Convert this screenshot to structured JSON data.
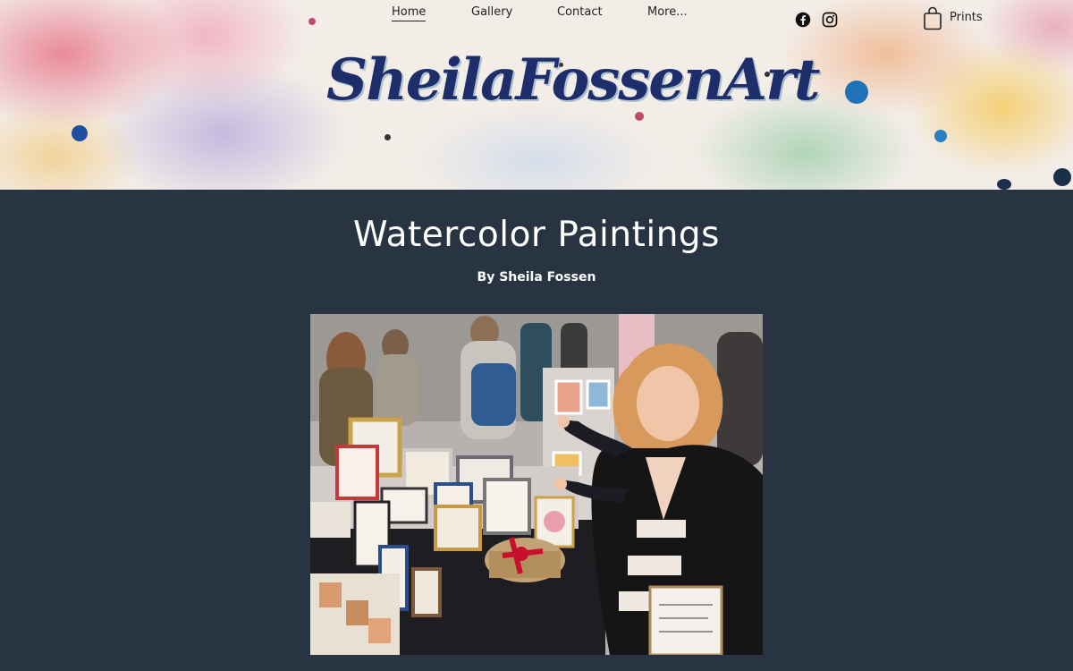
{
  "header": {
    "logo_text": "SheilaFossenArt",
    "nav": [
      {
        "label": "Home",
        "active": true
      },
      {
        "label": "Gallery",
        "active": false
      },
      {
        "label": "Contact",
        "active": false
      },
      {
        "label": "More...",
        "active": false
      }
    ],
    "social": [
      "facebook-icon",
      "instagram-icon"
    ],
    "cart_icon": "shopping-bag-icon",
    "cart_label": "Prints"
  },
  "main": {
    "title": "Watercolor Paintings",
    "subtitle": "By Sheila Fossen"
  },
  "colors": {
    "page_background": "#283442",
    "logo_text": "#1d2e6a",
    "title_text": "#ffffff"
  }
}
